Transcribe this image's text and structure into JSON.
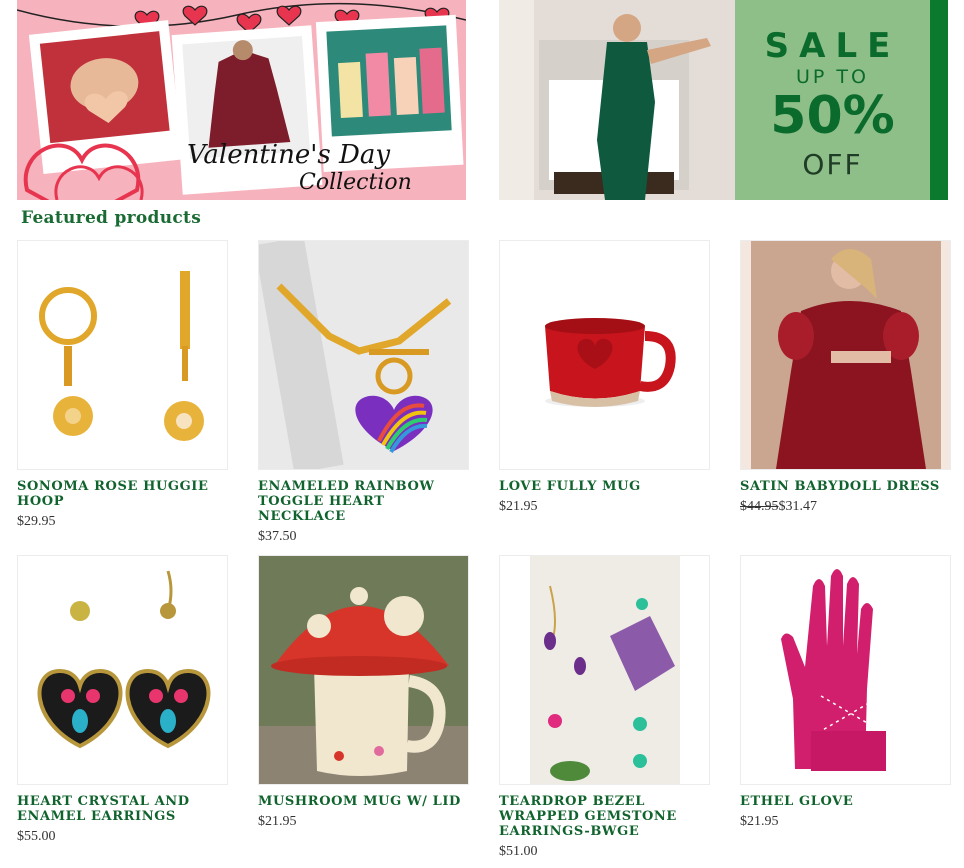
{
  "banners": {
    "valentine": {
      "script_line1": "Valentine's Day",
      "script_line2": "Collection"
    },
    "sale": {
      "line1": "SALE",
      "line2": "UP TO",
      "line3": "50%",
      "line4": "OFF"
    }
  },
  "section_title": "Featured products",
  "products": [
    {
      "name": "SONOMA ROSE HUGGIE HOOP",
      "price": "$29.95",
      "old_price": ""
    },
    {
      "name": "ENAMELED RAINBOW TOGGLE HEART NECKLACE",
      "price": "$37.50",
      "old_price": ""
    },
    {
      "name": "LOVE FULLY MUG",
      "price": "$21.95",
      "old_price": ""
    },
    {
      "name": "SATIN BABYDOLL DRESS",
      "price": "$31.47",
      "old_price": "$44.95"
    },
    {
      "name": "HEART CRYSTAL AND ENAMEL EARRINGS",
      "price": "$55.00",
      "old_price": ""
    },
    {
      "name": "MUSHROOM MUG W/ LID",
      "price": "$21.95",
      "old_price": ""
    },
    {
      "name": "TEARDROP BEZEL WRAPPED GEMSTONE EARRINGS-BWGE",
      "price": "$51.00",
      "old_price": ""
    },
    {
      "name": "ETHEL GLOVE",
      "price": "$21.95",
      "old_price": ""
    }
  ],
  "colors": {
    "accent_green": "#1a6b33",
    "sale_panel": "#8fbf88",
    "valentine_pink": "#f6b3bd"
  }
}
